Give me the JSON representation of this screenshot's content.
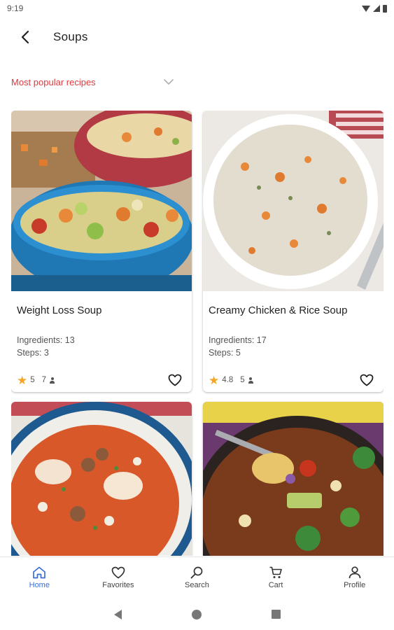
{
  "status_bar": {
    "time": "9:19"
  },
  "app_bar": {
    "title": "Soups"
  },
  "filter": {
    "selected": "Most popular recipes"
  },
  "recipes": [
    {
      "title": "Weight Loss Soup",
      "ingredients": "Ingredients: 13",
      "steps": "Steps: 3",
      "rating": "5",
      "reviews": "7"
    },
    {
      "title": "Creamy Chicken & Rice Soup",
      "ingredients": "Ingredients: 17",
      "steps": "Steps: 5",
      "rating": "4.8",
      "reviews": "5"
    },
    {
      "title": "",
      "ingredients": "",
      "steps": "",
      "rating": "",
      "reviews": ""
    },
    {
      "title": "",
      "ingredients": "",
      "steps": "",
      "rating": "",
      "reviews": ""
    }
  ],
  "bottom_nav": [
    {
      "label": "Home",
      "icon": "home-icon",
      "active": true
    },
    {
      "label": "Favorites",
      "icon": "heart-icon",
      "active": false
    },
    {
      "label": "Search",
      "icon": "search-icon",
      "active": false
    },
    {
      "label": "Cart",
      "icon": "cart-icon",
      "active": false
    },
    {
      "label": "Profile",
      "icon": "person-icon",
      "active": false
    }
  ],
  "colors": {
    "accent": "#e0383c",
    "nav_active": "#3b6fd8",
    "star": "#f5a623"
  }
}
